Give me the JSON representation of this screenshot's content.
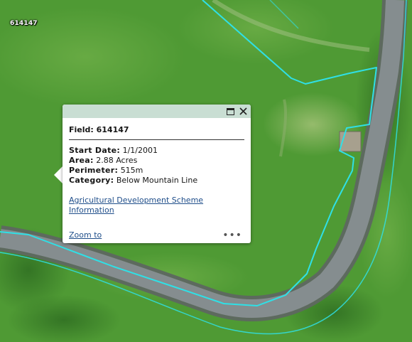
{
  "map": {
    "field_label": "614147",
    "colors": {
      "grass": "#4f9a34",
      "road": "#7c8486",
      "boundary": "#2fe0e6"
    }
  },
  "popup": {
    "title": "Field: 614147",
    "fields": [
      {
        "label": "Start Date:",
        "value": "1/1/2001"
      },
      {
        "label": "Area:",
        "value": "2.88 Acres"
      },
      {
        "label": "Perimeter:",
        "value": "515m"
      },
      {
        "label": "Category:",
        "value": "Below Mountain Line"
      }
    ],
    "scheme_link": "Agricultural Development Scheme Information",
    "zoom_link": "Zoom to",
    "more_label": "•••",
    "header_color": "#c9ded3",
    "link_color": "#1f4e8a"
  }
}
